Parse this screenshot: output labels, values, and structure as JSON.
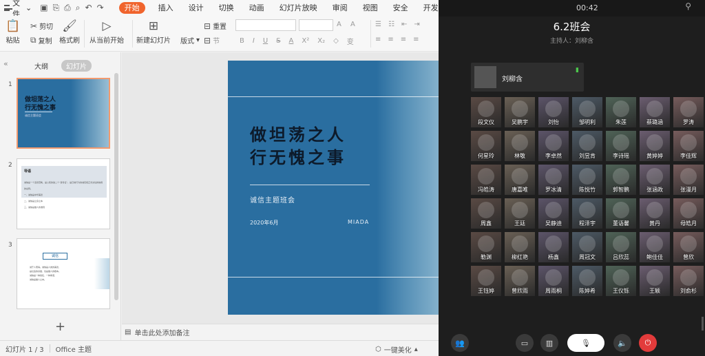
{
  "wps": {
    "menubar": {
      "file_label": "文件",
      "tabs": [
        "开始",
        "插入",
        "设计",
        "切换",
        "动画",
        "幻灯片放映",
        "审阅",
        "视图",
        "安全",
        "开发工具"
      ]
    },
    "ribbon": {
      "paste": "粘贴",
      "cut": "剪切",
      "copy": "复制",
      "format_painter": "格式刷",
      "play_from_current": "从当前开始",
      "new_slide": "新建幻灯片",
      "layout": "版式",
      "section": "节",
      "reset": "重置",
      "bold": "B",
      "italic": "I",
      "underline": "U",
      "strike": "S",
      "font_color": "A",
      "superscript": "X²",
      "subscript": "X₂",
      "grow_font": "A",
      "shrink_font": "A",
      "clear_format": "◇",
      "char_spacing": "变"
    },
    "left_pane": {
      "tab_outline": "大纲",
      "tab_slides": "幻灯片",
      "add_label": "+",
      "thumbnails": [
        {
          "num": "1",
          "title": "做坦荡之人\n行无愧之事",
          "sub": "诚信主题班会"
        },
        {
          "num": "2",
          "title": "导语",
          "lines": [
            "诚信是一个道德范畴，是公民的第二个“身份证”，是日常行为的诚实和正式交往的信用的总称。",
            "一、诚信是中华美德",
            "二、诚信是立身之本",
            "三、诚信是做人的准则"
          ]
        },
        {
          "num": "3",
          "title": "诚信",
          "lines": [
            "诚于人而得。诚信是人类的美德，",
            "是社会的基础，也是做人的根本。",
            "诚信是一种责任、一种承诺、",
            "诚信是做人之本。"
          ]
        }
      ]
    },
    "slide": {
      "title_line1": "做坦荡之人",
      "title_line2": "行无愧之事",
      "subtitle": "诚信主题班会",
      "date": "2020年6月",
      "author": "MIADA"
    },
    "notes_placeholder": "单击此处添加备注",
    "status": {
      "slide_count": "幻灯片 1 / 3",
      "theme": "Office 主题",
      "beautify": "一键美化"
    }
  },
  "meeting": {
    "time": "00:42",
    "title": "6.2班会",
    "host": "主持人：刘柳含",
    "speaker": "刘柳含",
    "participants": [
      "段文仪",
      "吴鹏宇",
      "刘怡",
      "邹明利",
      "朱莲",
      "蔡璐涵",
      "罗涛",
      "何星玲",
      "林敬",
      "李卓然",
      "刘昱肯",
      "李诗瑶",
      "黄婷婷",
      "李佳辉",
      "冯皓涛",
      "唐嘉唯",
      "罗冰清",
      "陈悦竹",
      "郭智鹏",
      "张涵政",
      "张漫月",
      "周鑫",
      "王廷",
      "吴静迪",
      "程泽宇",
      "董语馨",
      "黄丹",
      "母皓月",
      "勒渊",
      "柳红艳",
      "杨鑫",
      "周冠文",
      "吕欣蕊",
      "鲍佳佳",
      "曾欣",
      "王钰婷",
      "曾欣雨",
      "周雨桐",
      "陈婷希",
      "王仪铄",
      "王颖",
      "刘俞杉"
    ],
    "colors": {
      "mic_active": "#4cc64c",
      "end_call": "#e23b3b"
    }
  }
}
